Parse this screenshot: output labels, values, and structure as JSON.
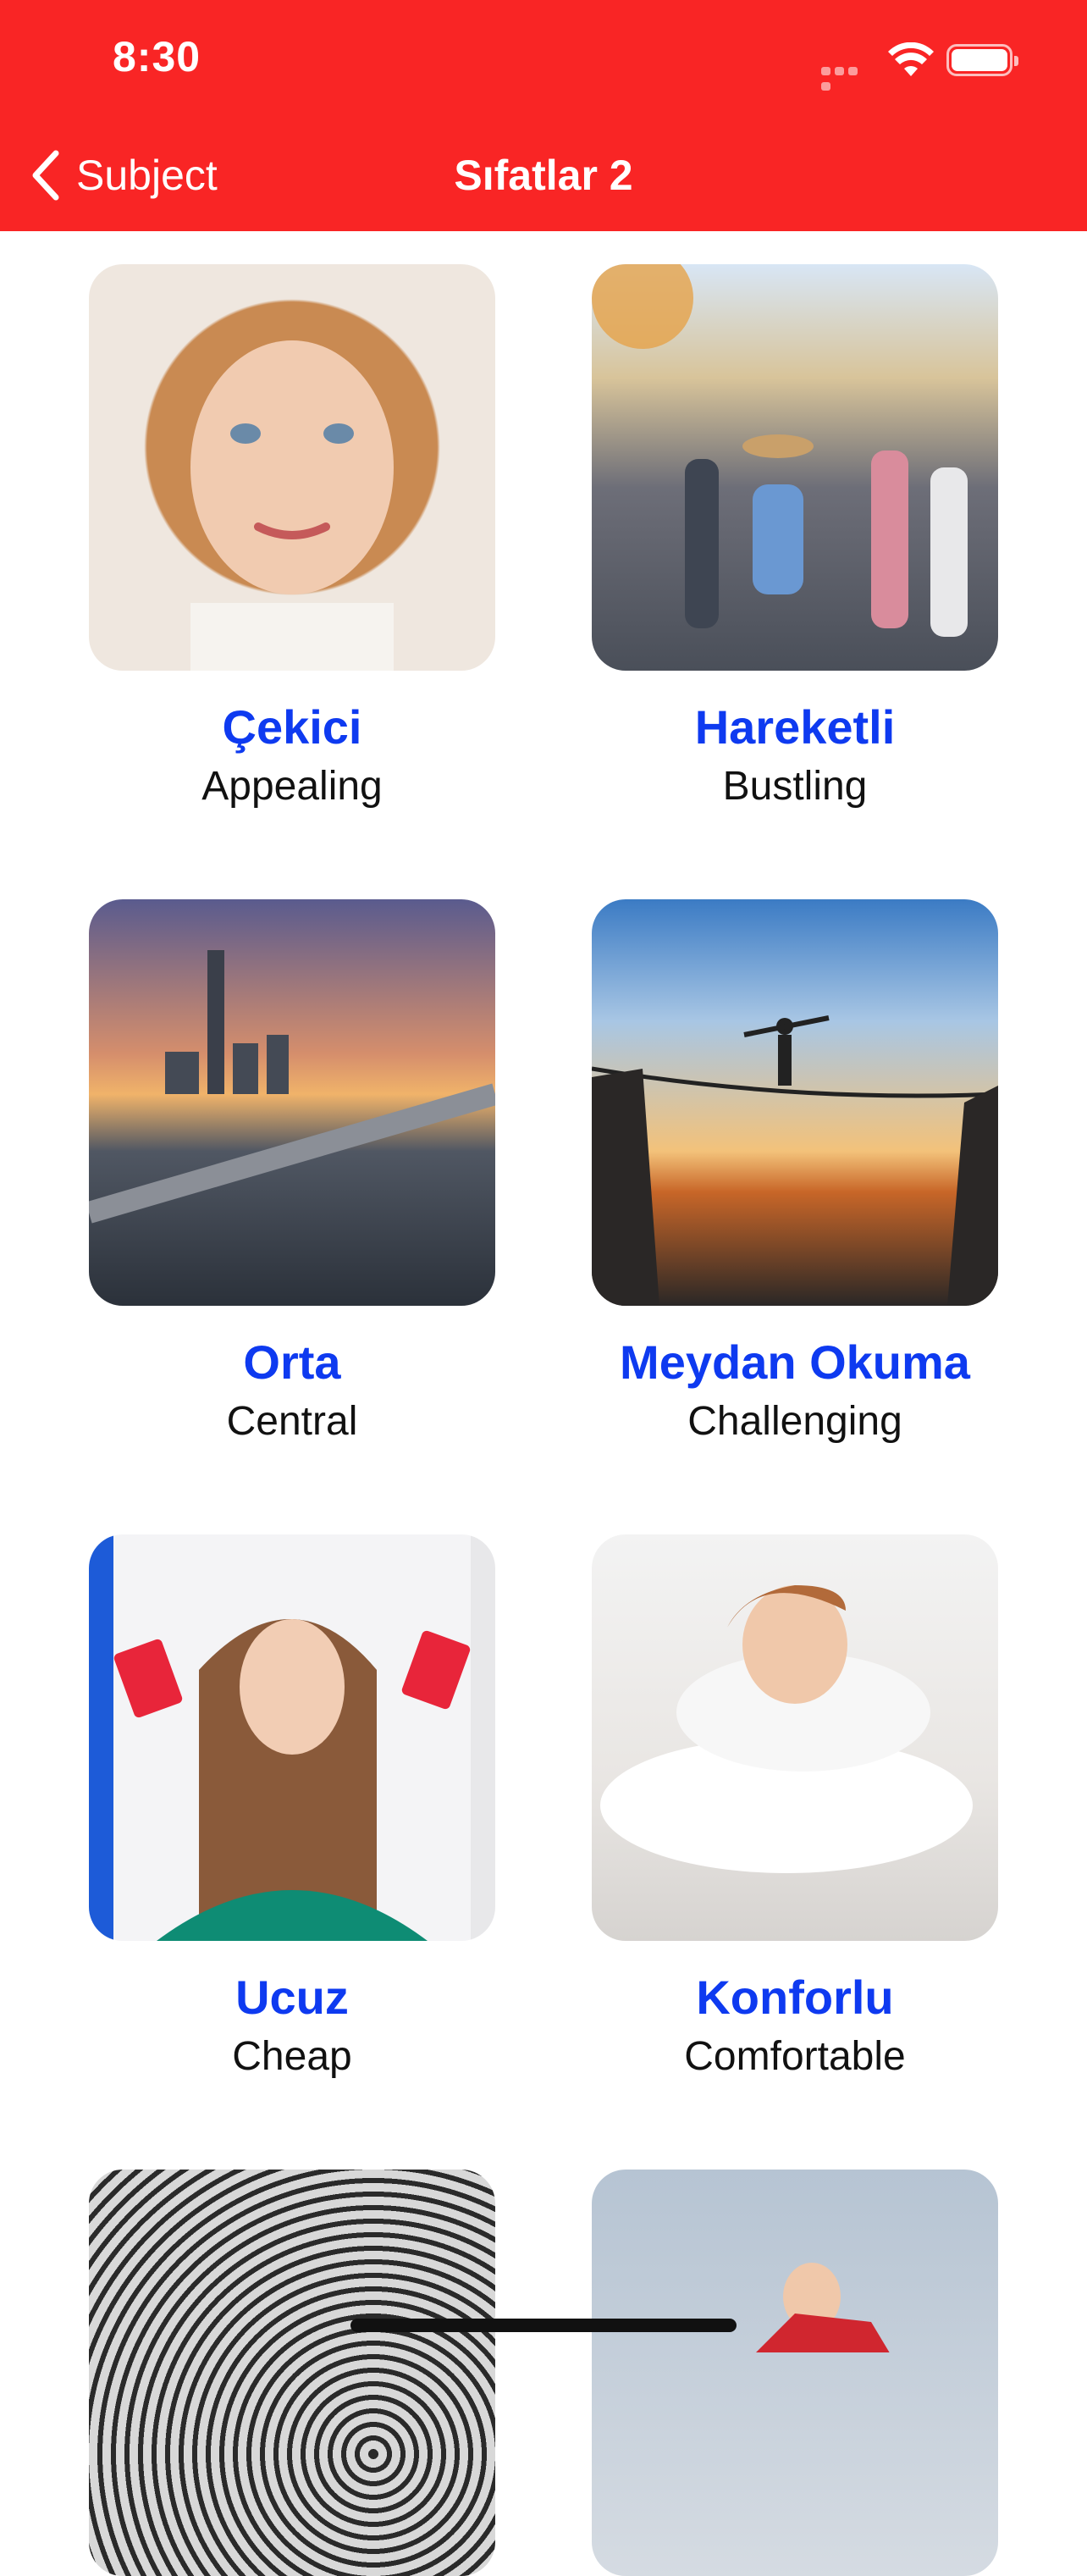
{
  "status_bar": {
    "time": "8:30"
  },
  "nav": {
    "back_label": "Subject",
    "title": "Sıfatlar 2"
  },
  "cards": [
    {
      "word": "Çekici",
      "meaning": "Appealing"
    },
    {
      "word": "Hareketli",
      "meaning": "Bustling"
    },
    {
      "word": "Orta",
      "meaning": "Central"
    },
    {
      "word": "Meydan Okuma",
      "meaning": "Challenging"
    },
    {
      "word": "Ucuz",
      "meaning": "Cheap"
    },
    {
      "word": "Konforlu",
      "meaning": "Comfortable"
    }
  ],
  "colors": {
    "header": "#f92525",
    "word": "#0e3af0",
    "meaning": "#111111"
  }
}
